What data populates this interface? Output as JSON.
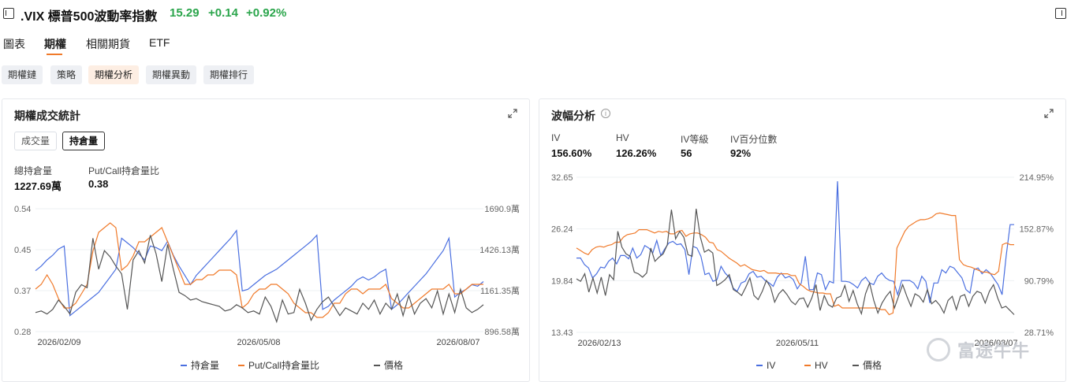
{
  "header": {
    "title": ".VIX 標普500波動率指數",
    "price": "15.29",
    "change": "+0.14",
    "change_pct": "+0.92%"
  },
  "tabs": [
    "圖表",
    "期權",
    "相關期貨",
    "ETF"
  ],
  "subtabs": [
    "期權鏈",
    "策略",
    "期權分析",
    "期權異動",
    "期權排行"
  ],
  "left_panel": {
    "title": "期權成交統計",
    "toggles": [
      "成交量",
      "持倉量"
    ],
    "stats": [
      {
        "label": "總持倉量",
        "value": "1227.69萬"
      },
      {
        "label": "Put/Call持倉量比",
        "value": "0.38"
      }
    ],
    "legend": [
      "持倉量",
      "Put/Call持倉量比",
      "價格"
    ]
  },
  "right_panel": {
    "title": "波幅分析",
    "info_glyph": "i",
    "stats": [
      {
        "label": "IV",
        "value": "156.60%"
      },
      {
        "label": "HV",
        "value": "126.26%"
      },
      {
        "label": "IV等級",
        "value": "56"
      },
      {
        "label": "IV百分位數",
        "value": "92%"
      }
    ],
    "legend": [
      "IV",
      "HV",
      "價格"
    ]
  },
  "watermark": "富途牛牛",
  "chart_data": [
    {
      "type": "line",
      "left_axis_ticks": [
        "0.54",
        "0.45",
        "0.37",
        "0.28"
      ],
      "right_axis_ticks": [
        "1690.9萬",
        "1426.13萬",
        "1161.35萬",
        "896.58萬"
      ],
      "x_ticks": [
        "2026/02/09",
        "2026/05/08",
        "2026/08/07"
      ],
      "colors": {
        "持倉量": "#4a6fe0",
        "Put/Call持倉量比": "#f07a2a",
        "價格": "#555555"
      },
      "series": [
        {
          "name": "持倉量",
          "axis": "right",
          "values": [
            1290,
            1320,
            1360,
            1390,
            1430,
            1450,
            1000,
            1030,
            1060,
            1090,
            1120,
            1150,
            1200,
            1250,
            1300,
            1500,
            1470,
            1440,
            1400,
            1360,
            1450,
            1440,
            1420,
            1480,
            1390,
            1320,
            1260,
            1200,
            1260,
            1300,
            1340,
            1380,
            1420,
            1460,
            1500,
            1550,
            1160,
            1170,
            1200,
            1230,
            1260,
            1280,
            1300,
            1330,
            1360,
            1390,
            1420,
            1450,
            1480,
            1520,
            1040,
            1060,
            1100,
            1130,
            1160,
            1190,
            1230,
            1250,
            1230,
            1250,
            1280,
            1300,
            1040,
            1070,
            1110,
            1150,
            1190,
            1230,
            1270,
            1320,
            1370,
            1420,
            1500,
            1120,
            1150,
            1170,
            1200,
            1190,
            1220
          ]
        },
        {
          "name": "Put/Call持倉量比",
          "axis": "left",
          "values": [
            0.37,
            0.38,
            0.4,
            0.38,
            0.35,
            0.33,
            0.33,
            0.34,
            0.36,
            0.38,
            0.45,
            0.49,
            0.5,
            0.51,
            0.5,
            0.41,
            0.42,
            0.44,
            0.47,
            0.47,
            0.48,
            0.49,
            0.5,
            0.47,
            0.44,
            0.41,
            0.38,
            0.38,
            0.39,
            0.39,
            0.4,
            0.4,
            0.41,
            0.41,
            0.41,
            0.4,
            0.33,
            0.34,
            0.36,
            0.37,
            0.37,
            0.38,
            0.38,
            0.37,
            0.36,
            0.34,
            0.33,
            0.32,
            0.32,
            0.31,
            0.31,
            0.32,
            0.34,
            0.34,
            0.36,
            0.37,
            0.37,
            0.36,
            0.37,
            0.37,
            0.37,
            0.38,
            0.35,
            0.34,
            0.33,
            0.33,
            0.34,
            0.35,
            0.36,
            0.37,
            0.37,
            0.37,
            0.38,
            0.36,
            0.36,
            0.37,
            0.38,
            0.38,
            0.38
          ]
        },
        {
          "name": "價格",
          "axis": "right",
          "values": [
            1020,
            1030,
            1010,
            1040,
            1100,
            1060,
            1010,
            1150,
            1200,
            1180,
            1500,
            1300,
            1420,
            1380,
            1320,
            1270,
            1040,
            1360,
            1420,
            1340,
            1520,
            1400,
            1220,
            1460,
            1300,
            1150,
            1130,
            1100,
            1110,
            1090,
            1080,
            1070,
            1060,
            1030,
            1040,
            1070,
            1050,
            1020,
            1030,
            1010,
            1120,
            1060,
            960,
            1100,
            1010,
            1020,
            1170,
            1080,
            970,
            1040,
            1090,
            1120,
            1060,
            1000,
            1050,
            1030,
            1010,
            1080,
            1040,
            1100,
            1010,
            1080,
            1040,
            1140,
            1000,
            1130,
            1010,
            1080,
            1110,
            1050,
            1160,
            1010,
            1140,
            1020,
            1170,
            1050,
            1020,
            1040,
            1070
          ]
        }
      ],
      "left_range": [
        0.28,
        0.54
      ],
      "right_range": [
        896.58,
        1690.9
      ]
    },
    {
      "type": "line",
      "left_axis_ticks": [
        "32.65",
        "26.24",
        "19.84",
        "13.43"
      ],
      "right_axis_ticks": [
        "214.95%",
        "152.87%",
        "90.79%",
        "28.71%"
      ],
      "x_ticks": [
        "2026/02/13",
        "2026/05/11",
        "2026/08/07"
      ],
      "colors": {
        "IV": "#4a6fe0",
        "HV": "#f07a2a",
        "價格": "#555555"
      },
      "series": [
        {
          "name": "IV",
          "axis": "right",
          "values": [
            118,
            118,
            110,
            106,
            94,
            99,
            107,
            106,
            114,
            118,
            111,
            121,
            121,
            117,
            130,
            118,
            122,
            133,
            130,
            124,
            139,
            121,
            129,
            136,
            138,
            134,
            135,
            128,
            98,
            132,
            130,
            120,
            98,
            100,
            90,
            92,
            108,
            100,
            95,
            82,
            78,
            88,
            90,
            99,
            102,
            95,
            96,
            91,
            88,
            84,
            95,
            100,
            94,
            96,
            92,
            81,
            88,
            120,
            80,
            80,
            100,
            98,
            80,
            90,
            88,
            210,
            90,
            90,
            89,
            86,
            82,
            91,
            95,
            88,
            86,
            96,
            100,
            94,
            91,
            90,
            74,
            91,
            91,
            91,
            88,
            81,
            96,
            90,
            64,
            88,
            88,
            104,
            100,
            108,
            106,
            100,
            94,
            80,
            76,
            104,
            106,
            99,
            104,
            100,
            93,
            86,
            74,
            120,
            158,
            158
          ]
        },
        {
          "name": "HV",
          "axis": "right",
          "values": [
            130,
            127,
            124,
            122,
            128,
            131,
            132,
            131,
            133,
            134,
            137,
            137,
            143,
            146,
            147,
            148,
            152,
            152,
            152,
            150,
            148,
            150,
            149,
            150,
            147,
            147,
            150,
            151,
            144,
            147,
            148,
            148,
            146,
            143,
            137,
            136,
            128,
            126,
            122,
            118,
            115,
            112,
            108,
            110,
            107,
            104,
            103,
            102,
            103,
            100,
            100,
            100,
            99,
            99,
            99,
            97,
            97,
            87,
            84,
            80,
            78,
            77,
            76,
            76,
            75,
            75,
            60,
            62,
            58,
            58,
            58,
            58,
            58,
            58,
            58,
            58,
            58,
            58,
            56,
            56,
            50,
            52,
            130,
            140,
            150,
            156,
            159,
            162,
            164,
            164,
            165,
            167,
            171,
            172,
            171,
            170,
            169,
            169,
            116,
            110,
            108,
            107,
            105,
            103,
            101,
            101,
            99,
            98,
            102,
            134,
            136,
            134,
            134
          ]
        },
        {
          "name": "價格",
          "axis": "right",
          "values": [
            93,
            90,
            99,
            77,
            94,
            76,
            95,
            73,
            98,
            92,
            150,
            131,
            123,
            120,
            101,
            99,
            95,
            100,
            130,
            114,
            119,
            123,
            134,
            176,
            141,
            150,
            143,
            122,
            120,
            177,
            143,
            125,
            128,
            124,
            85,
            88,
            92,
            98,
            80,
            77,
            73,
            83,
            94,
            73,
            68,
            78,
            91,
            83,
            65,
            75,
            80,
            74,
            66,
            62,
            69,
            70,
            59,
            70,
            86,
            55,
            73,
            62,
            59,
            70,
            72,
            85,
            66,
            79,
            63,
            51,
            75,
            88,
            67,
            52,
            64,
            72,
            78,
            58,
            72,
            86,
            72,
            60,
            75,
            72,
            65,
            80,
            63,
            67,
            61,
            52,
            67,
            72,
            56,
            72,
            74,
            60,
            72,
            78,
            76,
            64,
            78,
            86,
            70,
            58,
            60,
            55,
            50
          ]
        }
      ],
      "left_range": [
        13.43,
        32.65
      ],
      "right_range": [
        28.71,
        214.95
      ]
    }
  ]
}
